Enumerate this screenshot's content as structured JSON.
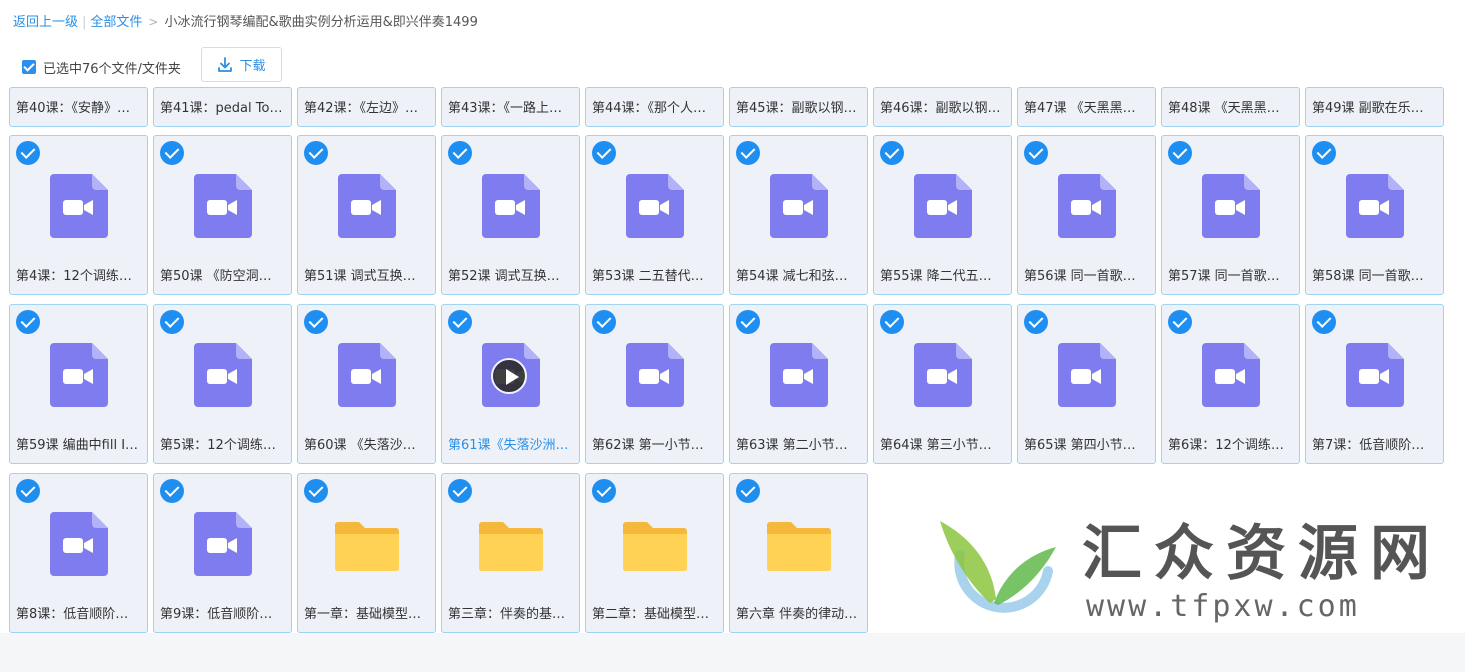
{
  "breadcrumb": {
    "back": "返回上一级",
    "all_files": "全部文件",
    "current": "小冰流行钢琴编配&歌曲实例分析运用&即兴伴奏1499"
  },
  "toolbar": {
    "selected_label": "已选中76个文件/文件夹",
    "download_label": "下载"
  },
  "colors": {
    "accent": "#2a8fe6",
    "video_icon": "#7f7cf0",
    "folder_icon": "#ffd256",
    "tile_border": "#9fd4f2"
  },
  "rows": [
    {
      "partial": true,
      "items": [
        {
          "name": "第40课：《安静》…",
          "type": "video"
        },
        {
          "name": "第41课：pedal To…",
          "type": "video"
        },
        {
          "name": "第42课：《左边》…",
          "type": "video"
        },
        {
          "name": "第43课：《一路上…",
          "type": "video"
        },
        {
          "name": "第44课：《那个人…",
          "type": "video"
        },
        {
          "name": "第45课：副歌以钢…",
          "type": "video"
        },
        {
          "name": "第46课：副歌以钢…",
          "type": "video"
        },
        {
          "name": "第47课 《天黑黑…",
          "type": "video"
        },
        {
          "name": "第48课 《天黑黑…",
          "type": "video"
        },
        {
          "name": "第49课 副歌在乐…",
          "type": "video"
        }
      ]
    },
    {
      "partial": false,
      "items": [
        {
          "name": "第4课：12个调练…",
          "type": "video"
        },
        {
          "name": "第50课 《防空洞…",
          "type": "video"
        },
        {
          "name": "第51课 调式互换…",
          "type": "video"
        },
        {
          "name": "第52课 调式互换…",
          "type": "video"
        },
        {
          "name": "第53课 二五替代…",
          "type": "video"
        },
        {
          "name": "第54课 减七和弦…",
          "type": "video"
        },
        {
          "name": "第55课 降二代五…",
          "type": "video"
        },
        {
          "name": "第56课 同一首歌…",
          "type": "video"
        },
        {
          "name": "第57课 同一首歌…",
          "type": "video"
        },
        {
          "name": "第58课 同一首歌…",
          "type": "video"
        }
      ]
    },
    {
      "partial": false,
      "items": [
        {
          "name": "第59课 编曲中fill I…",
          "type": "video"
        },
        {
          "name": "第5课：12个调练…",
          "type": "video"
        },
        {
          "name": "第60课 《失落沙…",
          "type": "video"
        },
        {
          "name": "第61课《失落沙洲…",
          "type": "video",
          "hover": true
        },
        {
          "name": "第62课 第一小节…",
          "type": "video"
        },
        {
          "name": "第63课 第二小节…",
          "type": "video"
        },
        {
          "name": "第64课 第三小节…",
          "type": "video"
        },
        {
          "name": "第65课 第四小节…",
          "type": "video"
        },
        {
          "name": "第6课：12个调练…",
          "type": "video"
        },
        {
          "name": "第7课：低音顺阶…",
          "type": "video"
        }
      ]
    },
    {
      "partial": false,
      "items": [
        {
          "name": "第8课：低音顺阶…",
          "type": "video"
        },
        {
          "name": "第9课：低音顺阶…",
          "type": "video"
        },
        {
          "name": "第一章：基础模型…",
          "type": "folder"
        },
        {
          "name": "第三章：伴奏的基…",
          "type": "folder"
        },
        {
          "name": "第二章：基础模型…",
          "type": "folder"
        },
        {
          "name": "第六章 伴奏的律动…",
          "type": "folder"
        }
      ]
    }
  ],
  "watermark": {
    "title": "汇众资源网",
    "url": "www.tfpxw.com"
  }
}
